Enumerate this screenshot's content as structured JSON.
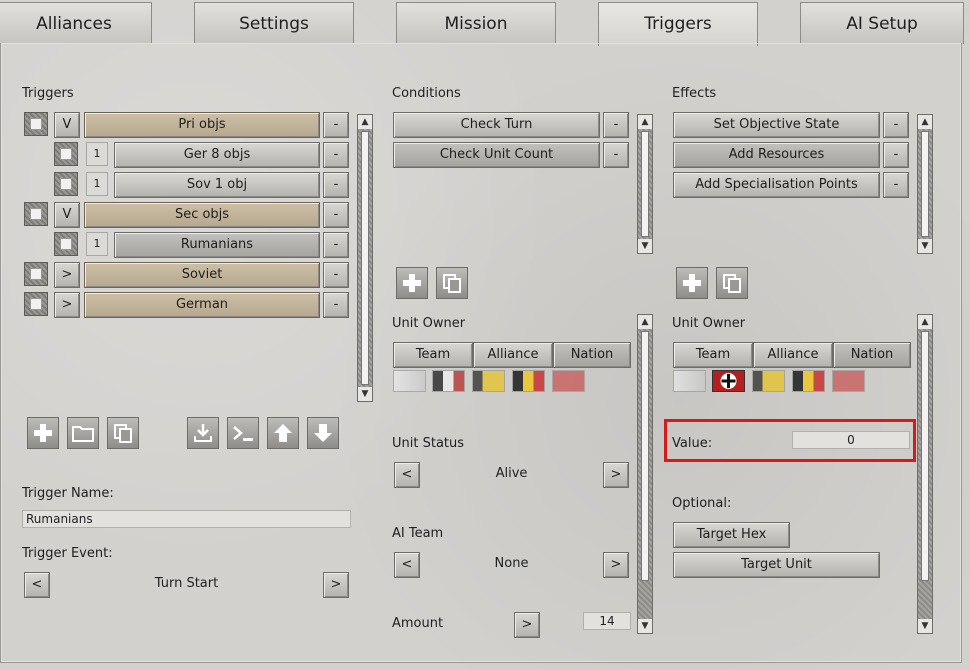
{
  "tabs": [
    {
      "label": "Alliances"
    },
    {
      "label": "Settings"
    },
    {
      "label": "Mission"
    },
    {
      "label": "Triggers"
    },
    {
      "label": "AI Setup"
    }
  ],
  "triggers": {
    "title": "Triggers",
    "rows": [
      {
        "toggle": "V",
        "label": "Pri objs",
        "remove": "-"
      },
      {
        "count": "1",
        "label": "Ger 8 objs",
        "remove": "-"
      },
      {
        "count": "1",
        "label": "Sov 1 obj",
        "remove": "-"
      },
      {
        "toggle": "V",
        "label": "Sec objs",
        "remove": "-"
      },
      {
        "count": "1",
        "label": "Rumanians",
        "remove": "-"
      },
      {
        "toggle": ">",
        "label": "Soviet",
        "remove": "-"
      },
      {
        "toggle": ">",
        "label": "German",
        "remove": "-"
      }
    ],
    "name_label": "Trigger Name:",
    "name_value": "Rumanians",
    "event_label": "Trigger Event:",
    "event_prev": "<",
    "event_value": "Turn Start",
    "event_next": ">"
  },
  "conditions": {
    "title": "Conditions",
    "items": [
      {
        "label": "Check Turn",
        "remove": "-"
      },
      {
        "label": "Check Unit Count",
        "remove": "-"
      }
    ],
    "unit_owner_label": "Unit Owner",
    "owner_buttons": [
      "Team",
      "Alliance",
      "Nation"
    ],
    "unit_status_label": "Unit Status",
    "unit_status_value": "Alive",
    "ai_team_label": "AI Team",
    "ai_team_value": "None",
    "amount_label": "Amount",
    "amount_value": "14",
    "prev": "<",
    "next": ">"
  },
  "effects": {
    "title": "Effects",
    "items": [
      {
        "label": "Set Objective State",
        "remove": "-"
      },
      {
        "label": "Add Resources",
        "remove": "-"
      },
      {
        "label": "Add Specialisation Points",
        "remove": "-"
      }
    ],
    "unit_owner_label": "Unit Owner",
    "owner_buttons": [
      "Team",
      "Alliance",
      "Nation"
    ],
    "value_label": "Value:",
    "value": "0",
    "optional_label": "Optional:",
    "target_hex": "Target Hex",
    "target_unit": "Target Unit"
  },
  "colors": {
    "highlight": "#d41a1a",
    "tan_button": "#c2b49a"
  }
}
